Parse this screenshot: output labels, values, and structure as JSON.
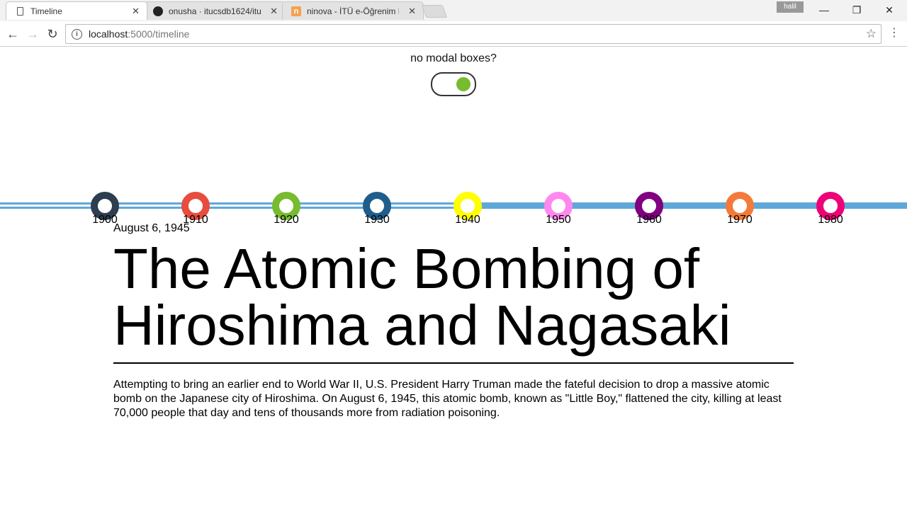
{
  "browser": {
    "tabs": [
      {
        "title": "Timeline",
        "icon": "document-icon"
      },
      {
        "title": "onusha · itucsdb1624/itu",
        "icon": "github-icon"
      },
      {
        "title": "ninova - İTÜ e-Öğrenim M",
        "icon": "ninova-icon"
      }
    ],
    "profile_name": "halil",
    "url_host": "localhost",
    "url_path": ":5000/timeline"
  },
  "page": {
    "toggle_label": "no modal boxes?",
    "toggle_on": true,
    "toggle_color": "#77bb2f",
    "timeline": {
      "line_color": "#5fa8d8",
      "selected_year": "1940",
      "years": [
        {
          "label": "1900",
          "color": "#2c3e50"
        },
        {
          "label": "1910",
          "color": "#e74c3c"
        },
        {
          "label": "1920",
          "color": "#77bb2f"
        },
        {
          "label": "1930",
          "color": "#1f5e8c"
        },
        {
          "label": "1940",
          "color": "#ffff00"
        },
        {
          "label": "1950",
          "color": "#ff88ee"
        },
        {
          "label": "1960",
          "color": "#800080"
        },
        {
          "label": "1970",
          "color": "#f47a3a"
        },
        {
          "label": "1980",
          "color": "#ee0077"
        }
      ]
    },
    "event": {
      "date": "August 6, 1945",
      "title": "The Atomic Bombing of Hiroshima and Nagasaki",
      "text": "Attempting to bring an earlier end to World War II, U.S. President Harry Truman made the fateful decision to drop a massive atomic bomb on the Japanese city of Hiroshima. On August 6, 1945, this atomic bomb, known as \"Little Boy,\" flattened the city, killing at least 70,000 people that day and tens of thousands more from radiation poisoning."
    }
  }
}
